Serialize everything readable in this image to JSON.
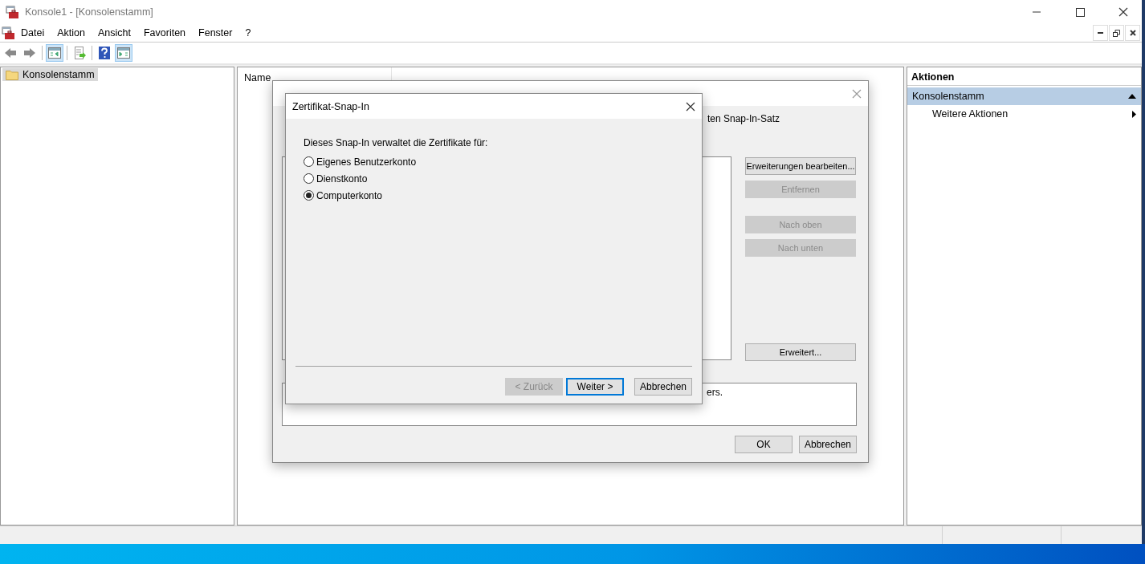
{
  "window": {
    "title": "Konsole1 - [Konsolenstamm]"
  },
  "menu": [
    "Datei",
    "Aktion",
    "Ansicht",
    "Favoriten",
    "Fenster",
    "?"
  ],
  "toolbar": [
    {
      "kind": "back",
      "selected": false
    },
    {
      "kind": "forward",
      "selected": false
    },
    {
      "kind": "tree",
      "selected": true
    },
    {
      "kind": "export",
      "selected": false
    },
    {
      "kind": "help",
      "selected": false
    },
    {
      "kind": "actionpane",
      "selected": true
    }
  ],
  "tree": {
    "items": [
      {
        "label": "Konsolenstamm",
        "selected": true
      }
    ]
  },
  "list": {
    "columns": [
      "Name"
    ]
  },
  "actions": {
    "header": "Aktionen",
    "sections": [
      {
        "title": "Konsolenstamm",
        "expanded": true,
        "items": [
          {
            "label": "Weitere Aktionen"
          }
        ]
      }
    ]
  },
  "background_dialog": {
    "line_1_end": "ten Snap-In-Satz",
    "description_text": "ers.",
    "side_buttons": [
      {
        "label": "Erweiterungen bearbeiten...",
        "disabled": false
      },
      {
        "label": "Entfernen",
        "disabled": true
      },
      {
        "label": "Nach oben",
        "disabled": true
      },
      {
        "label": "Nach unten",
        "disabled": true
      },
      {
        "label": "Erweitert...",
        "disabled": false
      }
    ],
    "buttons": [
      {
        "label": "OK",
        "disabled": false
      },
      {
        "label": "Abbrechen",
        "disabled": false
      }
    ]
  },
  "dialog": {
    "title": "Zertifikat-Snap-In",
    "prompt": "Dieses Snap-In verwaltet die Zertifikate für:",
    "options": [
      {
        "label": "Eigenes Benutzerkonto",
        "selected": false
      },
      {
        "label": "Dienstkonto",
        "selected": false
      },
      {
        "label": "Computerkonto",
        "selected": true
      }
    ],
    "buttons": [
      {
        "label": "< Zurück",
        "disabled": true,
        "default": false
      },
      {
        "label": "Weiter >",
        "disabled": false,
        "default": true
      },
      {
        "label": "Abbrechen",
        "disabled": false,
        "default": false
      }
    ]
  }
}
